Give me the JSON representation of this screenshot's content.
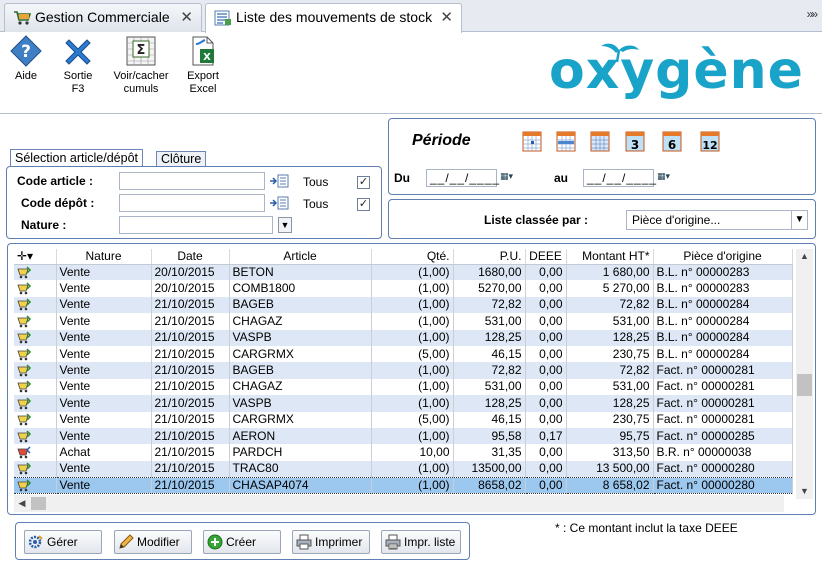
{
  "tabs": [
    {
      "label": "Gestion Commerciale",
      "close": "✕"
    },
    {
      "label": "Liste des mouvements de stock",
      "close": "✕"
    }
  ],
  "tab_overflow": "»»",
  "toolbar": {
    "aide": "Aide",
    "sortie": "Sortie\nF3",
    "cumuls": "Voir/cacher\ncumuls",
    "export": "Export\nExcel"
  },
  "logo_text": "oxygène",
  "selection": {
    "tab_active": "Sélection article/dépôt",
    "tab_inactive": "Clôture",
    "code_article_label": "Code article :",
    "code_depot_label": "Code dépôt :",
    "nature_label": "Nature :",
    "tous1": "Tous",
    "tous2": "Tous",
    "code_article_value": "",
    "code_depot_value": "",
    "nature_value": ""
  },
  "periode": {
    "title": "Période",
    "du_label": "Du",
    "au_label": "au",
    "du_value": "__/__/____",
    "au_value": "__/__/____",
    "quick_buttons": [
      "",
      "",
      "",
      "3",
      "6",
      "12"
    ]
  },
  "liste_classee": {
    "label": "Liste classée par :",
    "value": "Pièce d'origine..."
  },
  "colors": {
    "accent_blue": "#5f7fb3",
    "row_alt": "#dde7f5",
    "row_selected": "#9cc7ef",
    "logo_teal": "#1aa3c8"
  },
  "grid": {
    "columns": [
      "Nature",
      "Date",
      "Article",
      "Qté.",
      "P.U.",
      "DEEE",
      "Montant HT*",
      "Pièce d'origine"
    ],
    "rows": [
      {
        "icon": "sale-icon",
        "nature": "Vente",
        "date": "20/10/2015",
        "article": "BETON",
        "qte": "(1,00)",
        "pu": "1680,00",
        "deee": "0,00",
        "montant": "1 680,00",
        "piece": "B.L. n° 00000283"
      },
      {
        "icon": "sale-icon",
        "nature": "Vente",
        "date": "20/10/2015",
        "article": "COMB1800",
        "qte": "(1,00)",
        "pu": "5270,00",
        "deee": "0,00",
        "montant": "5 270,00",
        "piece": "B.L. n° 00000283"
      },
      {
        "icon": "sale-icon",
        "nature": "Vente",
        "date": "21/10/2015",
        "article": "BAGEB",
        "qte": "(1,00)",
        "pu": "72,82",
        "deee": "0,00",
        "montant": "72,82",
        "piece": "B.L. n° 00000284"
      },
      {
        "icon": "sale-icon",
        "nature": "Vente",
        "date": "21/10/2015",
        "article": "CHAGAZ",
        "qte": "(1,00)",
        "pu": "531,00",
        "deee": "0,00",
        "montant": "531,00",
        "piece": "B.L. n° 00000284"
      },
      {
        "icon": "sale-icon",
        "nature": "Vente",
        "date": "21/10/2015",
        "article": "VASPB",
        "qte": "(1,00)",
        "pu": "128,25",
        "deee": "0,00",
        "montant": "128,25",
        "piece": "B.L. n° 00000284"
      },
      {
        "icon": "sale-icon",
        "nature": "Vente",
        "date": "21/10/2015",
        "article": "CARGRMX",
        "qte": "(5,00)",
        "pu": "46,15",
        "deee": "0,00",
        "montant": "230,75",
        "piece": "B.L. n° 00000284"
      },
      {
        "icon": "sale-icon",
        "nature": "Vente",
        "date": "21/10/2015",
        "article": "BAGEB",
        "qte": "(1,00)",
        "pu": "72,82",
        "deee": "0,00",
        "montant": "72,82",
        "piece": "Fact. n° 00000281"
      },
      {
        "icon": "sale-icon",
        "nature": "Vente",
        "date": "21/10/2015",
        "article": "CHAGAZ",
        "qte": "(1,00)",
        "pu": "531,00",
        "deee": "0,00",
        "montant": "531,00",
        "piece": "Fact. n° 00000281"
      },
      {
        "icon": "sale-icon",
        "nature": "Vente",
        "date": "21/10/2015",
        "article": "VASPB",
        "qte": "(1,00)",
        "pu": "128,25",
        "deee": "0,00",
        "montant": "128,25",
        "piece": "Fact. n° 00000281"
      },
      {
        "icon": "sale-icon",
        "nature": "Vente",
        "date": "21/10/2015",
        "article": "CARGRMX",
        "qte": "(5,00)",
        "pu": "46,15",
        "deee": "0,00",
        "montant": "230,75",
        "piece": "Fact. n° 00000281"
      },
      {
        "icon": "sale-icon",
        "nature": "Vente",
        "date": "21/10/2015",
        "article": "AERON",
        "qte": "(1,00)",
        "pu": "95,58",
        "deee": "0,17",
        "montant": "95,75",
        "piece": "Fact. n° 00000285"
      },
      {
        "icon": "purchase-icon",
        "nature": "Achat",
        "date": "21/10/2015",
        "article": "PARDCH",
        "qte": "10,00",
        "pu": "31,35",
        "deee": "0,00",
        "montant": "313,50",
        "piece": "B.R. n° 00000038"
      },
      {
        "icon": "sale-icon",
        "nature": "Vente",
        "date": "21/10/2015",
        "article": "TRAC80",
        "qte": "(1,00)",
        "pu": "13500,00",
        "deee": "0,00",
        "montant": "13 500,00",
        "piece": "Fact. n° 00000280"
      },
      {
        "icon": "sale-icon",
        "nature": "Vente",
        "date": "21/10/2015",
        "article": "CHASAP4074",
        "qte": "(1,00)",
        "pu": "8658,02",
        "deee": "0,00",
        "montant": "8 658,02",
        "piece": "Fact. n° 00000280"
      }
    ]
  },
  "actions": {
    "gerer": "Gérer",
    "modifier": "Modifier",
    "creer": "Créer",
    "imprimer": "Imprimer",
    "impr_liste": "Impr. liste"
  },
  "footnote": "* : Ce montant inclut la taxe DEEE"
}
